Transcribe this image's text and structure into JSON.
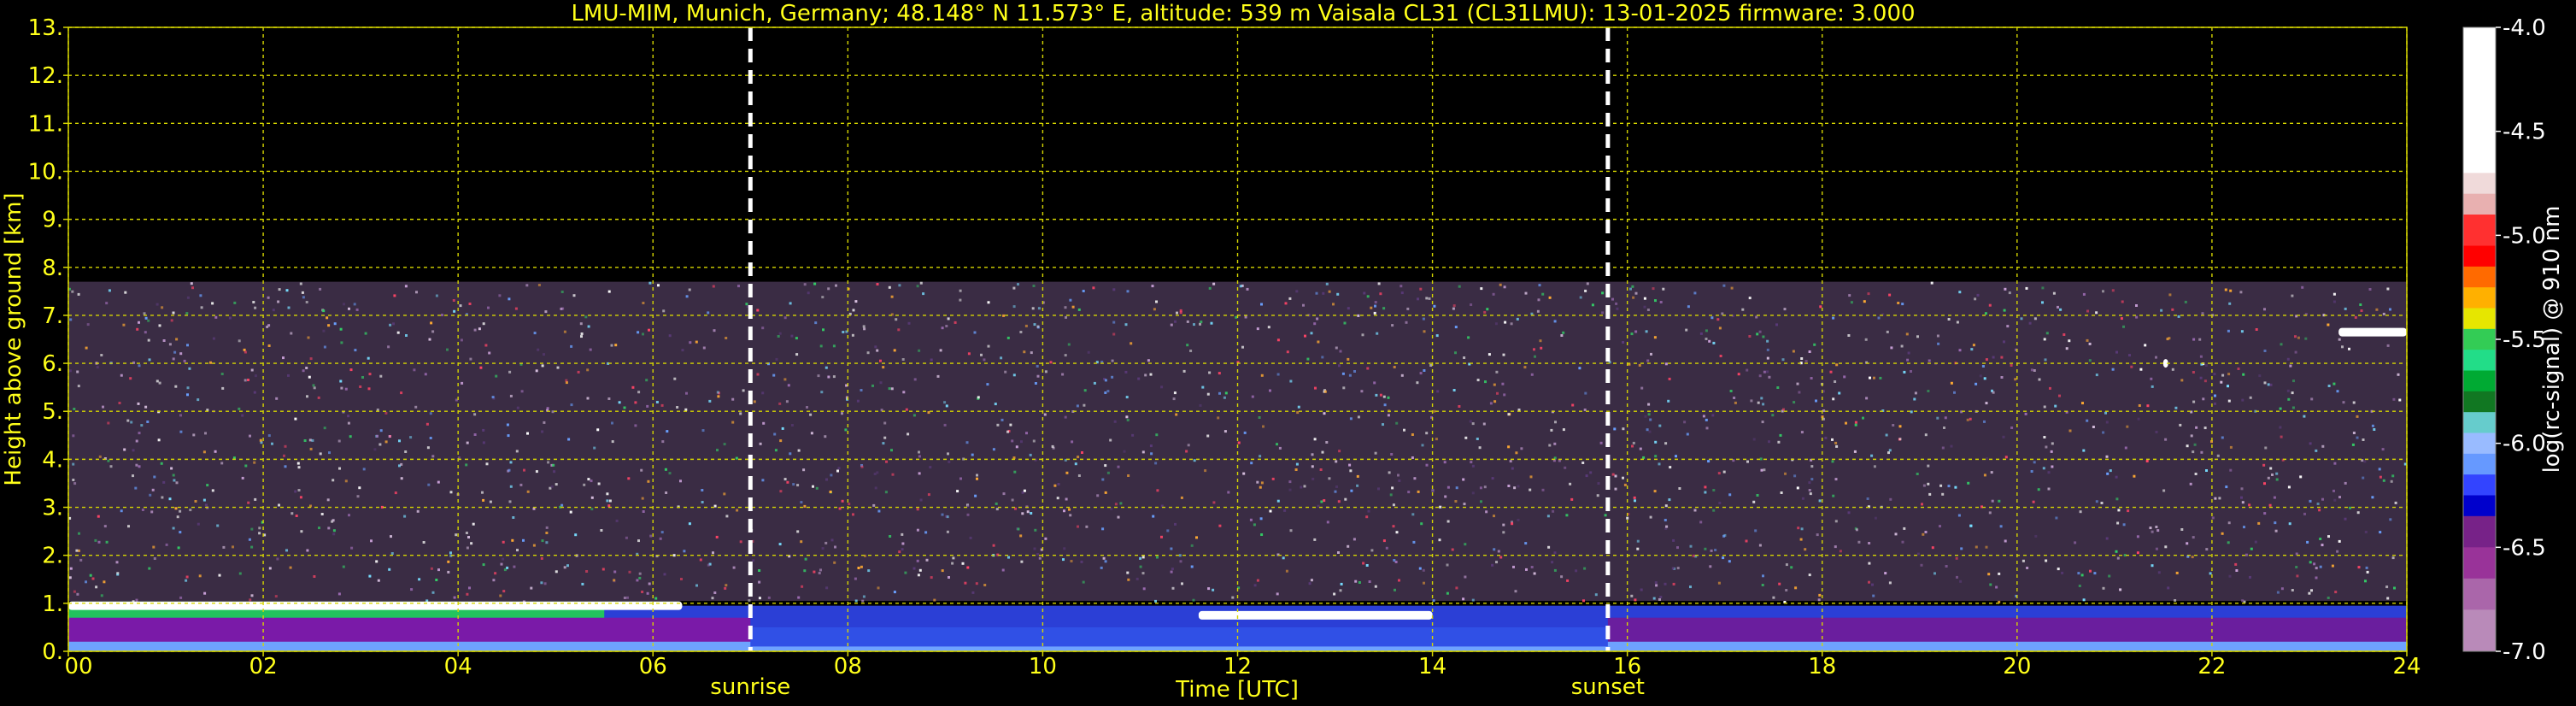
{
  "title": "LMU-MIM, Munich, Germany; 48.148° N 11.573° E, altitude: 539 m    Vaisala CL31 (CL31LMU): 13-01-2025    firmware: 3.000",
  "colors": {
    "text": "#ffff1a",
    "grid": "#d6d600",
    "background": "#000000",
    "marker": "#ffffff"
  },
  "chart_data": {
    "type": "heatmap",
    "title": "LMU-MIM, Munich, Germany; 48.148° N 11.573° E, altitude: 539 m    Vaisala CL31 (CL31LMU): 13-01-2025    firmware: 3.000",
    "xlabel": "Time [UTC]",
    "ylabel": "Height above ground [km]",
    "xlim": [
      0,
      24
    ],
    "ylim": [
      0,
      13
    ],
    "xticks": [
      0,
      2,
      4,
      6,
      8,
      10,
      12,
      14,
      16,
      18,
      20,
      22,
      24
    ],
    "xtick_labels": [
      "00",
      "02",
      "04",
      "06",
      "08",
      "10",
      "12",
      "14",
      "16",
      "18",
      "20",
      "22",
      "24"
    ],
    "yticks": [
      0,
      1,
      2,
      3,
      4,
      5,
      6,
      7,
      8,
      9,
      10,
      11,
      12,
      13
    ],
    "ytick_labels": [
      "0.",
      "1.",
      "2.",
      "3.",
      "4.",
      "5.",
      "6.",
      "7.",
      "8.",
      "9.",
      "10.",
      "11.",
      "12.",
      "13."
    ],
    "grid": true,
    "noise_top_km": 7.7,
    "boundary_layer_top_km": 0.9,
    "events": [
      {
        "name": "sunrise",
        "time": 7.0
      },
      {
        "name": "sunset",
        "time": 15.8
      }
    ],
    "cloud_layers": [
      {
        "start": 0.0,
        "end": 6.3,
        "height": 0.95
      },
      {
        "start": 11.6,
        "end": 14.0,
        "height": 0.75
      },
      {
        "start": 21.5,
        "end": 21.55,
        "height": 6.0
      },
      {
        "start": 23.3,
        "end": 24.0,
        "height": 6.65
      }
    ],
    "colorbar": {
      "label": "log(rc-signal) @ 910 nm",
      "range": [
        -7.0,
        -4.0
      ],
      "ticks": [
        -4.0,
        -4.5,
        -5.0,
        -5.5,
        -6.0,
        -6.5,
        -7.0
      ],
      "tick_labels": [
        "-4.0",
        "-4.5",
        "-5.0",
        "-5.5",
        "-6.0",
        "-6.5",
        "-7.0"
      ]
    }
  }
}
